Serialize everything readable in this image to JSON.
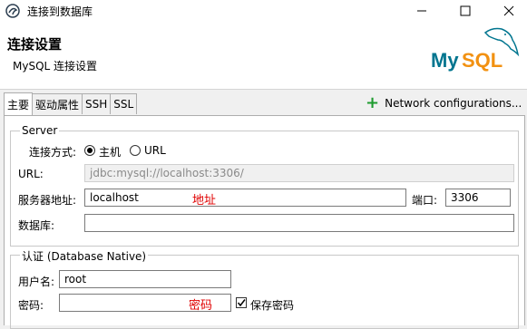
{
  "window": {
    "title": "连接到数据库",
    "minimize_icon": "minimize-icon",
    "maximize_icon": "maximize-icon",
    "close_icon": "close-icon"
  },
  "header": {
    "title": "连接设置",
    "subtitle": "MySQL 连接设置",
    "logo_text": "MySQL"
  },
  "tabs": [
    {
      "label": "主要",
      "active": true
    },
    {
      "label": "驱动属性"
    },
    {
      "label": "SSH"
    },
    {
      "label": "SSL"
    }
  ],
  "network_config": {
    "label": "Network configurations..."
  },
  "server": {
    "group_label": "Server",
    "connect_mode_label": "连接方式:",
    "options": [
      "主机",
      "URL"
    ],
    "selected": "主机",
    "url_label": "URL:",
    "url_value": "jdbc:mysql://localhost:3306/",
    "host_label": "服务器地址:",
    "host_value": "localhost",
    "host_annotation": "地址",
    "port_label": "端口:",
    "port_value": "3306",
    "database_label": "数据库:",
    "database_value": ""
  },
  "auth": {
    "group_label": "认证 (Database Native)",
    "username_label": "用户名:",
    "username_value": "root",
    "password_label": "密码:",
    "password_value": "",
    "password_annotation": "密码",
    "save_password_label": "保存密码",
    "save_password_checked": true
  },
  "colors": {
    "accent_green": "#1e9b2f",
    "annotation_red": "#e00000",
    "mysql_blue": "#00758f",
    "mysql_orange": "#f29111"
  }
}
